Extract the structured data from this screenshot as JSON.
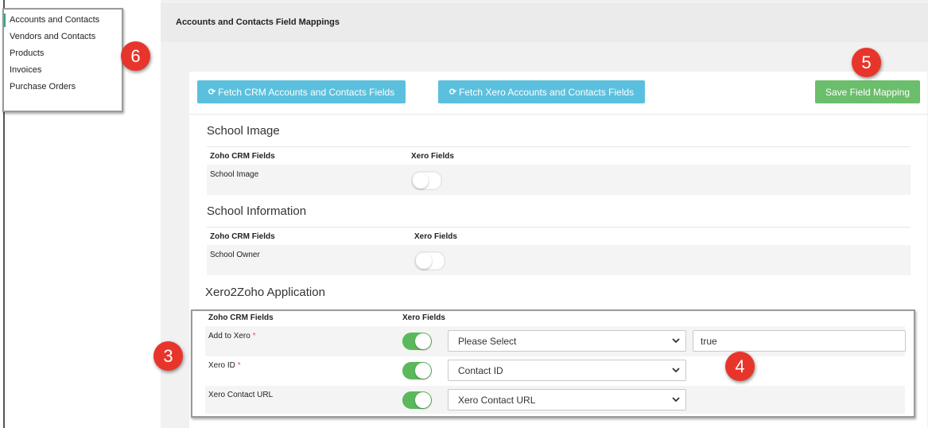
{
  "sidebar": {
    "items": [
      {
        "label": "Accounts and Contacts",
        "active": true
      },
      {
        "label": "Vendors and Contacts",
        "active": false
      },
      {
        "label": "Products",
        "active": false
      },
      {
        "label": "Invoices",
        "active": false
      },
      {
        "label": "Purchase Orders",
        "active": false
      }
    ]
  },
  "header": {
    "title": "Accounts and Contacts Field Mappings"
  },
  "toolbar": {
    "fetch_crm_label": "Fetch CRM Accounts and Contacts Fields",
    "fetch_xero_label": "Fetch Xero Accounts and Contacts Fields",
    "save_label": "Save Field Mapping",
    "refresh_icon": "refresh-icon"
  },
  "sections": [
    {
      "title": "School Image",
      "col_crm": "Zoho CRM Fields",
      "col_xero": "Xero Fields",
      "rows": [
        {
          "label": "School Image",
          "required": false,
          "toggle": false
        }
      ]
    },
    {
      "title": "School Information",
      "col_crm": "Zoho CRM Fields",
      "col_xero": "Xero Fields",
      "rows": [
        {
          "label": "School Owner",
          "required": false,
          "toggle": false
        }
      ]
    },
    {
      "title": "Xero2Zoho Application",
      "col_crm": "Zoho CRM Fields",
      "col_xero": "Xero Fields",
      "rows": [
        {
          "label": "Add to Xero",
          "required": true,
          "toggle": true,
          "select": "Please Select",
          "value": "true"
        },
        {
          "label": "Xero ID",
          "required": true,
          "toggle": true,
          "select": "Contact ID"
        },
        {
          "label": "Xero Contact URL",
          "required": false,
          "toggle": true,
          "select": "Xero Contact URL"
        }
      ]
    }
  ],
  "required_marker": "*",
  "callouts": [
    "6",
    "5",
    "3",
    "4"
  ],
  "colors": {
    "accent_blue": "#5bc0de",
    "accent_green": "#5cb85c",
    "badge_red": "#e8352b"
  }
}
